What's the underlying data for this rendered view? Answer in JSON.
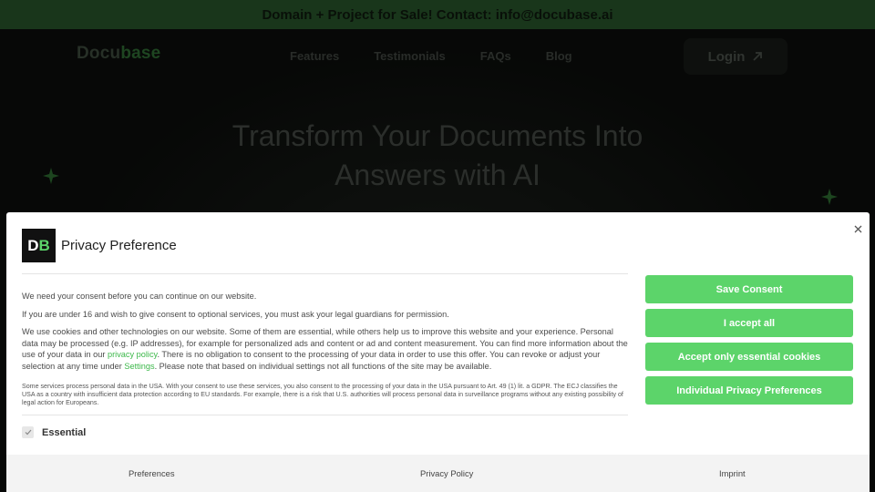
{
  "topbar": {
    "text": "Domain + Project for Sale! Contact: info@docubase.ai"
  },
  "nav": {
    "logo_main": "Docu",
    "logo_accent": "base",
    "links": [
      "Features",
      "Testimonials",
      "FAQs",
      "Blog"
    ],
    "login_label": "Login",
    "login_icon": "arrow-up-right-icon"
  },
  "hero": {
    "title_line1": "Transform Your Documents Into",
    "title_line2": "Answers with AI"
  },
  "modal": {
    "brand_d": "D",
    "brand_b": "B",
    "title": "Privacy Preference",
    "close_icon": "close-icon",
    "p1": "We need your consent before you can continue on our website.",
    "p2": "If you are under 16 and wish to give consent to optional services, you must ask your legal guardians for permission.",
    "p3_a": "We use cookies and other technologies on our website. Some of them are essential, while others help us to improve this website and your experience. Personal data may be processed (e.g. IP addresses), for example for personalized ads and content or ad and content measurement. You can find more information about the use of your data in our ",
    "p3_link1": "privacy policy",
    "p3_b": ". There is no obligation to consent to the processing of your data in order to use this offer. You can revoke or adjust your selection at any time under ",
    "p3_link2": "Settings",
    "p3_c": ". Please note that based on individual settings not all functions of the site may be available.",
    "fine_print": "Some services process personal data in the USA. With your consent to use these services, you also consent to the processing of your data in the USA pursuant to Art. 49 (1) lit. a GDPR. The ECJ classifies the USA as a country with insufficient data protection according to EU standards. For example, there is a risk that U.S. authorities will process personal data in surveillance programs without any existing possibility of legal action for Europeans.",
    "essential_label": "Essential",
    "buttons": [
      "Save Consent",
      "I accept all",
      "Accept only essential cookies",
      "Individual Privacy Preferences"
    ],
    "footer": [
      "Preferences",
      "Privacy Policy",
      "Imprint"
    ]
  },
  "colors": {
    "accent": "#5cd46a",
    "topbar": "#27532a"
  }
}
